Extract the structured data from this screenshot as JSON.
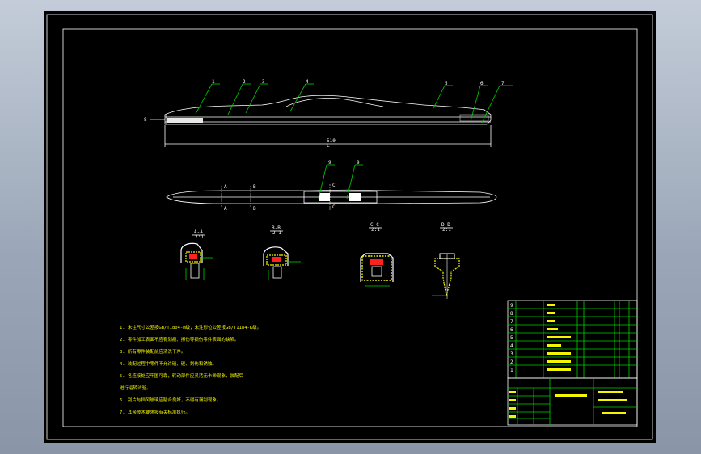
{
  "balloons_top": [
    "1",
    "2",
    "3",
    "4",
    "5",
    "6",
    "7"
  ],
  "left_marker": "8",
  "balloons_mid": [
    "9",
    "9"
  ],
  "sections": [
    {
      "title": "A-A",
      "scale": "2:1"
    },
    {
      "title": "B-B",
      "scale": "2:1"
    },
    {
      "title": "C-C",
      "scale": "2:1"
    },
    {
      "title": "D-D",
      "scale": "2:1"
    }
  ],
  "notes": [
    "1. 未注尺寸公差按GB/T1804-m级，未注形位公差按GB/T1184-K级。",
    "2. 零件加工表面不应有划痕、擦伤等损伤零件表面的缺陷。",
    "3. 所有零件装配前应清洗干净。",
    "4. 装配过程中零件不允许磕、碰、划伤和锈蚀。",
    "5. 各连接处应牢固可靠，转动部件应灵活无卡滞现象，装配后",
    "   进行运转试验。",
    "6. 刮片与挡风玻璃应贴合良好，不得有漏刮现象。",
    "7. 其余技术要求按有关标准执行。"
  ],
  "bom_rows": [
    {
      "no": "9"
    },
    {
      "no": "8"
    },
    {
      "no": "7"
    },
    {
      "no": "6"
    },
    {
      "no": "5"
    },
    {
      "no": "4"
    },
    {
      "no": "3"
    },
    {
      "no": "2"
    },
    {
      "no": "1"
    }
  ]
}
